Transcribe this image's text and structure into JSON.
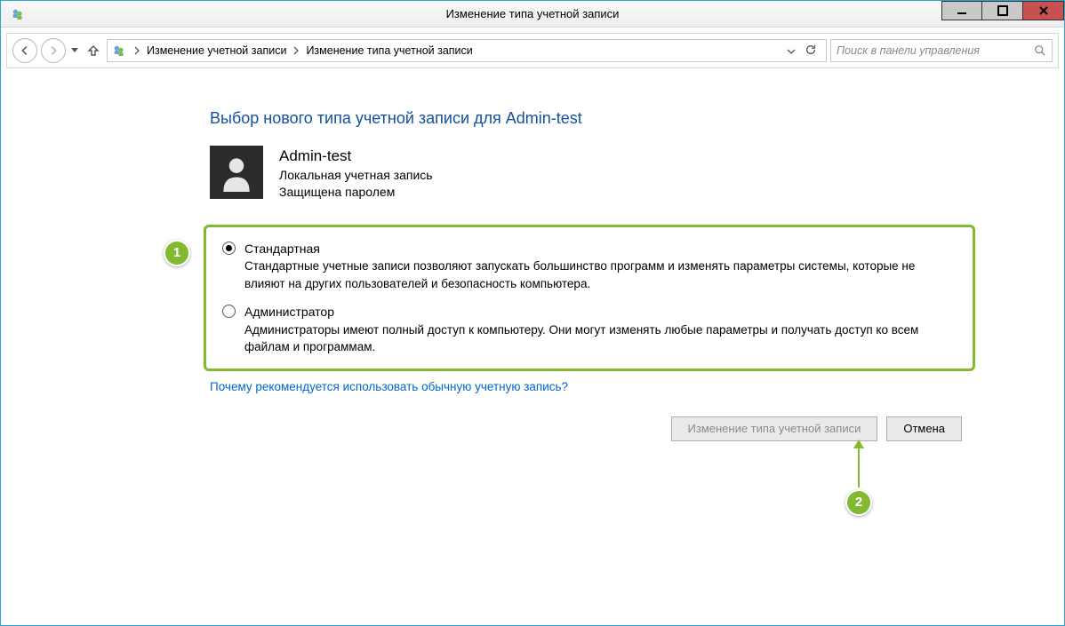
{
  "window": {
    "title": "Изменение типа учетной записи"
  },
  "breadcrumbs": {
    "item1": "Изменение учетной записи",
    "item2": "Изменение типа учетной записи"
  },
  "search": {
    "placeholder": "Поиск в панели управления"
  },
  "heading": "Выбор нового типа учетной записи для Admin-test",
  "user": {
    "name": "Admin-test",
    "type": "Локальная учетная запись",
    "protected": "Защищена паролем"
  },
  "options": {
    "standard": {
      "label": "Стандартная",
      "desc": "Стандартные учетные записи позволяют запускать большинство программ и изменять параметры системы, которые не влияют на других пользователей и безопасность компьютера."
    },
    "admin": {
      "label": "Администратор",
      "desc": "Администраторы имеют полный доступ к компьютеру. Они могут изменять любые параметры и получать доступ ко всем файлам и программам."
    }
  },
  "help_link": "Почему рекомендуется использовать обычную учетную запись?",
  "buttons": {
    "apply": "Изменение типа учетной записи",
    "cancel": "Отмена"
  },
  "callouts": {
    "one": "1",
    "two": "2"
  }
}
